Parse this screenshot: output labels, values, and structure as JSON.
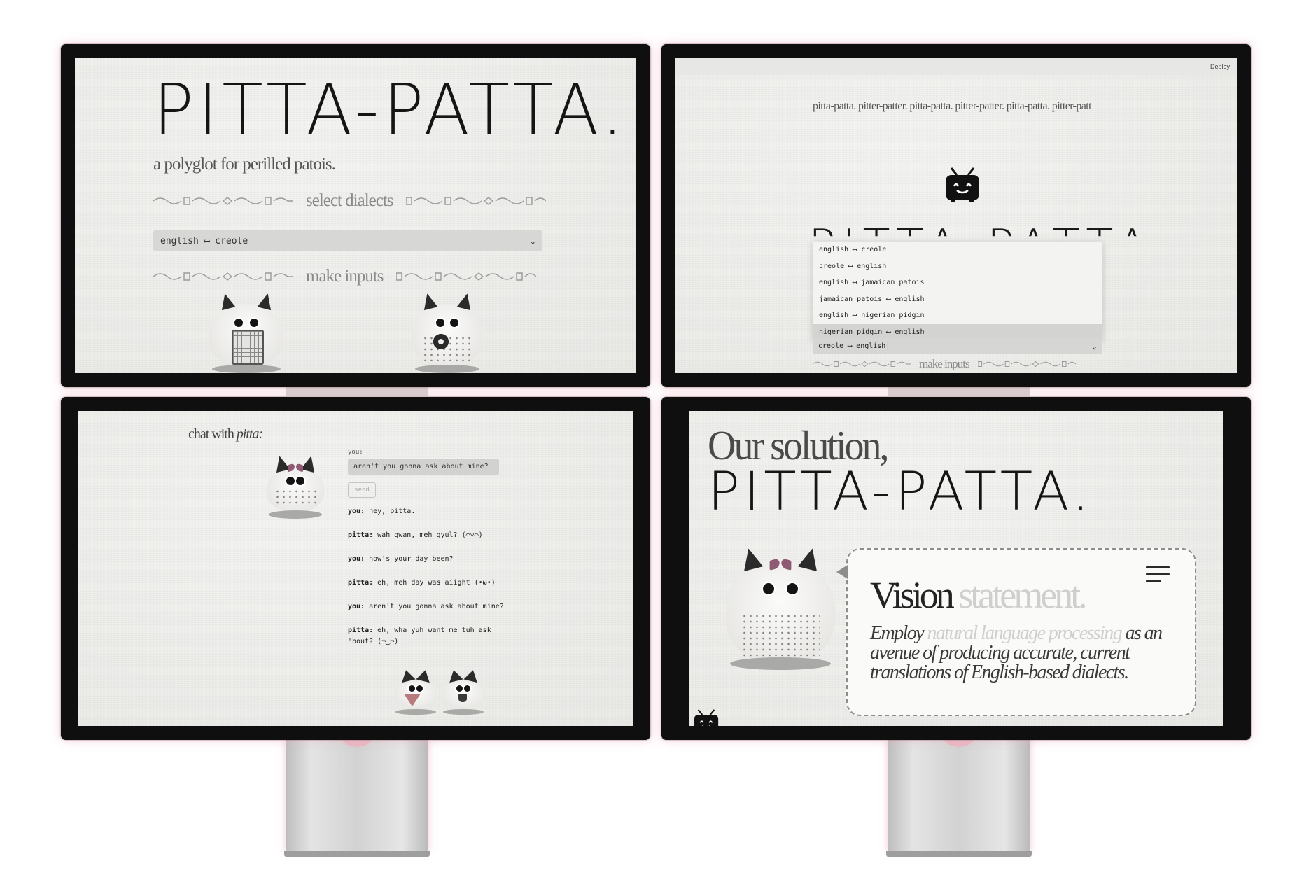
{
  "screen1": {
    "title": "PITTA-PATTA.",
    "subtitle": "a polyglot for perilled patois.",
    "divider_select": "select dialects",
    "divider_inputs": "make inputs",
    "select_value": "english ⟷ creole"
  },
  "screen2": {
    "deploy": "Deploy",
    "marquee": "pitta-patta. pitter-patter. pitta-patta. pitter-patter. pitta-patta. pitter-patt",
    "partial_title": "PITTA-PATTA.",
    "options": [
      "english ⟷ creole",
      "creole ⟷ english",
      "english ⟷ jamaican patois",
      "jamaican patois ⟷ english",
      "english ⟷ nigerian pidgin",
      "nigerian pidgin ⟷ english"
    ],
    "select_value": "creole ⟷ english|",
    "divider_inputs": "make inputs"
  },
  "screen3": {
    "heading_prefix": "chat with ",
    "heading_name": "pitta:",
    "you_label": "you:",
    "input_value": "aren't you gonna ask about mine?",
    "send_label": "send",
    "messages": [
      {
        "speaker": "you:",
        "text": "hey, pitta."
      },
      {
        "speaker": "pitta:",
        "text": "wah gwan, meh gyul? (⌒▽⌒)"
      },
      {
        "speaker": "you:",
        "text": "how's your day been?"
      },
      {
        "speaker": "pitta:",
        "text": "eh, meh day was aiight (•ω•)"
      },
      {
        "speaker": "you:",
        "text": "aren't you gonna ask about mine?"
      },
      {
        "speaker": "pitta:",
        "text": "eh, wha yuh want me tuh ask 'bout? (¬‿¬)"
      }
    ]
  },
  "screen4": {
    "our_solution": "Our solution,",
    "title": "PITTA-PATTA.",
    "vision_dark": "Vision",
    "vision_light": " statement.",
    "body_a": "Employ ",
    "body_light": "natural language processing",
    "body_b": " as an avenue of producing accurate, current translations of English-based dialects."
  },
  "colors": {
    "background": "#ffffff",
    "bezel": "#0f0f0f",
    "paper": "#eeeeec",
    "glow": "#e9b9c4",
    "bow": "#8f5b74"
  },
  "icons": [
    "tv-mascot-icon",
    "chevron-down-icon",
    "hamburger-menu-icon",
    "ornament-divider-icon"
  ]
}
